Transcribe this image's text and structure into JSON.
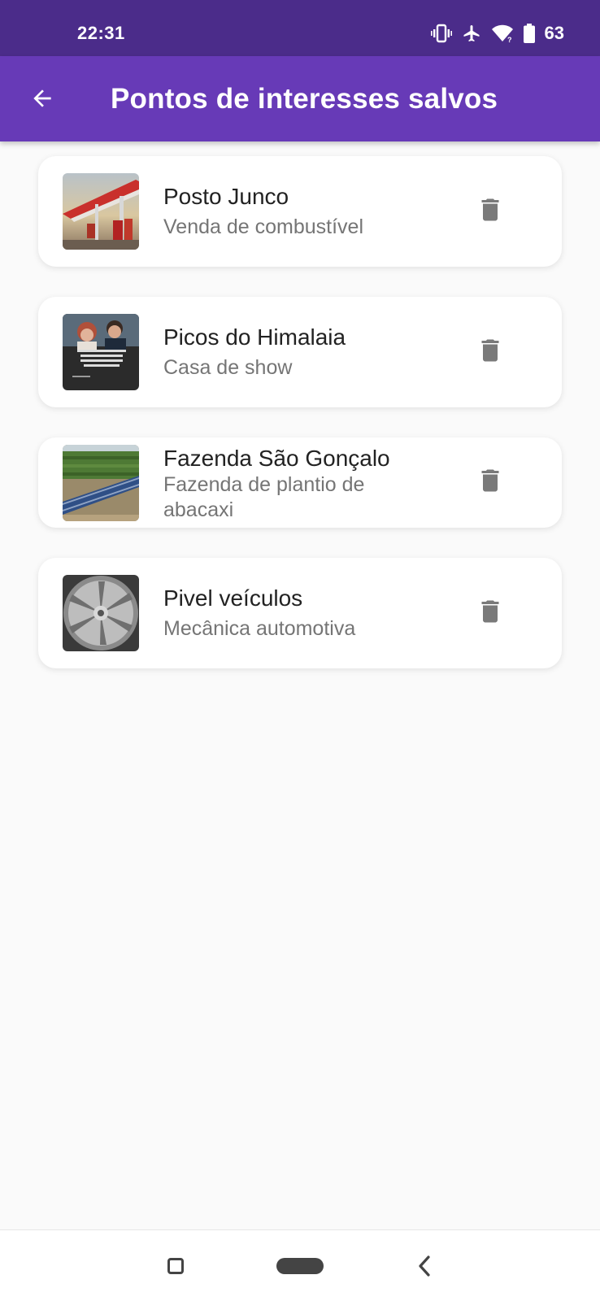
{
  "status_bar": {
    "time": "22:31",
    "battery_level": "63",
    "icons": [
      "vibrate-icon",
      "airplane-mode-icon",
      "wifi-icon",
      "battery-icon"
    ]
  },
  "app_bar": {
    "title": "Pontos de interesses salvos",
    "back_icon": "arrow-back-icon"
  },
  "colors": {
    "status_bar": "#4b2c8a",
    "app_bar": "#673ab7",
    "background": "#fafafa",
    "card": "#ffffff",
    "title_text": "#222222",
    "subtitle_text": "#757575",
    "delete_icon": "#7a7a7a"
  },
  "places": [
    {
      "title": "Posto Junco",
      "subtitle": "Venda de combustível",
      "thumbnail_icon": "gas-station-photo",
      "action_icon": "trash-icon"
    },
    {
      "title": "Picos do Himalaia",
      "subtitle": "Casa de show",
      "thumbnail_icon": "people-poster-photo",
      "action_icon": "trash-icon"
    },
    {
      "title": "Fazenda São Gonçalo",
      "subtitle": "Fazenda de plantio de abacaxi",
      "thumbnail_icon": "farm-solar-panel-photo",
      "action_icon": "trash-icon"
    },
    {
      "title": "Pivel veículos",
      "subtitle": "Mecânica automotiva",
      "thumbnail_icon": "car-wheel-photo",
      "action_icon": "trash-icon"
    }
  ],
  "nav_bar": {
    "icons": [
      "recent-apps-icon",
      "home-pill-icon",
      "back-chevron-icon"
    ]
  }
}
